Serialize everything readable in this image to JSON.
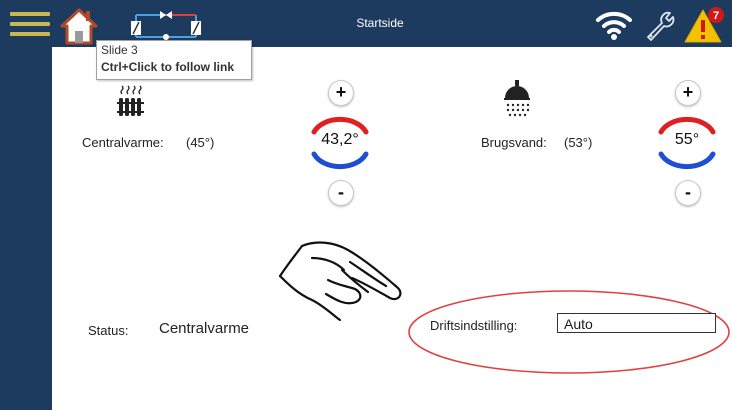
{
  "header": {
    "title": "Startside",
    "alert_count": "7"
  },
  "tooltip": {
    "line1": "Slide 3",
    "line2": "Ctrl+Click to follow link"
  },
  "heating": {
    "label": "Centralvarme:",
    "setpoint": "(45°)",
    "current": "43,2°",
    "plus": "+",
    "minus": "-"
  },
  "hot_water": {
    "label": "Brugsvand:",
    "setpoint": "(53°)",
    "current": "55°",
    "plus": "+",
    "minus": "-"
  },
  "status": {
    "label": "Status:",
    "value": "Centralvarme"
  },
  "operating_mode": {
    "label": "Driftsindstilling:",
    "value": "Auto"
  },
  "colors": {
    "bar": "#1d3a5f",
    "menu": "#c7b94f",
    "hot": "#e02020",
    "cold": "#1f4fd1",
    "warning": "#f2c200",
    "highlight_ring": "#e04040"
  }
}
